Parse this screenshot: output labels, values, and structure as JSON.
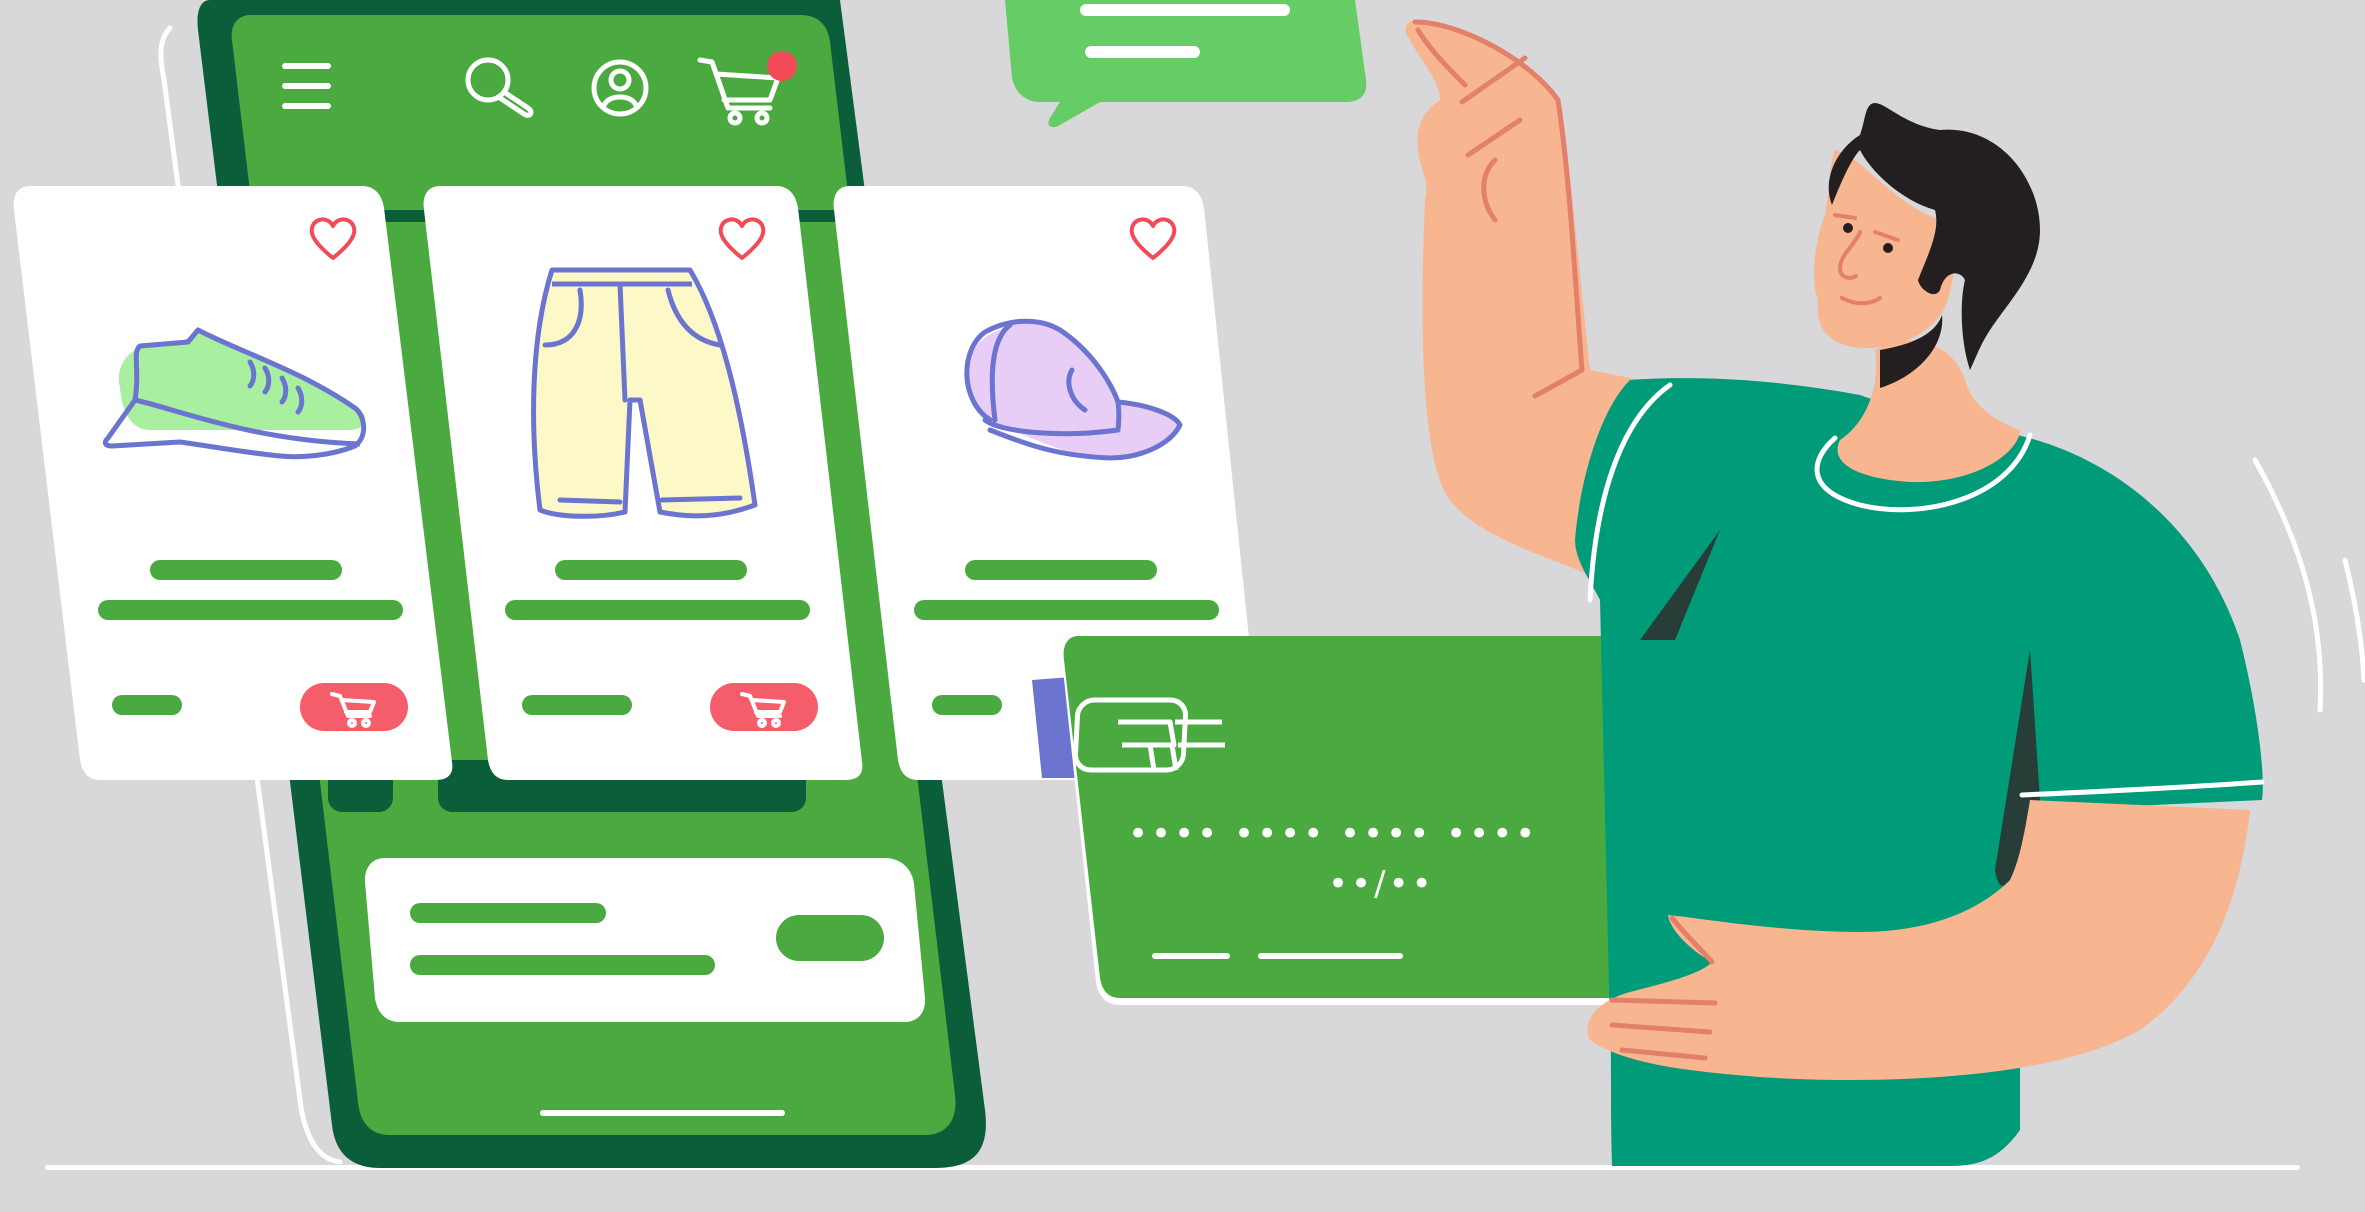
{
  "colors": {
    "background": "#d8d7da",
    "phone_frame": "#0b5e3a",
    "phone_screen": "#4aaa3f",
    "accent_green": "#4aaa3f",
    "light_green": "#66cc66",
    "card_white": "#ffffff",
    "cart_button": "#f65d6b",
    "notification_dot": "#f24b57",
    "heart": "#f24b57",
    "product_outline": "#6b74cf",
    "sneaker_fill": "#a8ef9f",
    "shorts_fill": "#fdf8c8",
    "cap_fill": "#e8cdf7",
    "shirt": "#009b79",
    "skin": "#f8b690",
    "skin_line": "#e2806a",
    "hair": "#231f20",
    "credit_card_back": "#6b74cf"
  },
  "phone": {
    "header_icons": [
      "menu-icon",
      "search-icon",
      "user-icon",
      "cart-icon"
    ],
    "has_cart_notification": true
  },
  "products": [
    {
      "icon": "sneaker-icon",
      "favorite_icon": "heart-icon",
      "action_icon": "cart-icon"
    },
    {
      "icon": "shorts-icon",
      "favorite_icon": "heart-icon",
      "action_icon": "cart-icon"
    },
    {
      "icon": "cap-icon",
      "favorite_icon": "heart-icon",
      "action_icon": "cart-icon"
    }
  ],
  "credit_card": {
    "chip_icon": "chip-icon",
    "number_masked": "•••• •••• •••• ••••",
    "expiry_masked": "••/••"
  },
  "speech_bubble": {
    "icon": "chat-bubble-icon"
  }
}
